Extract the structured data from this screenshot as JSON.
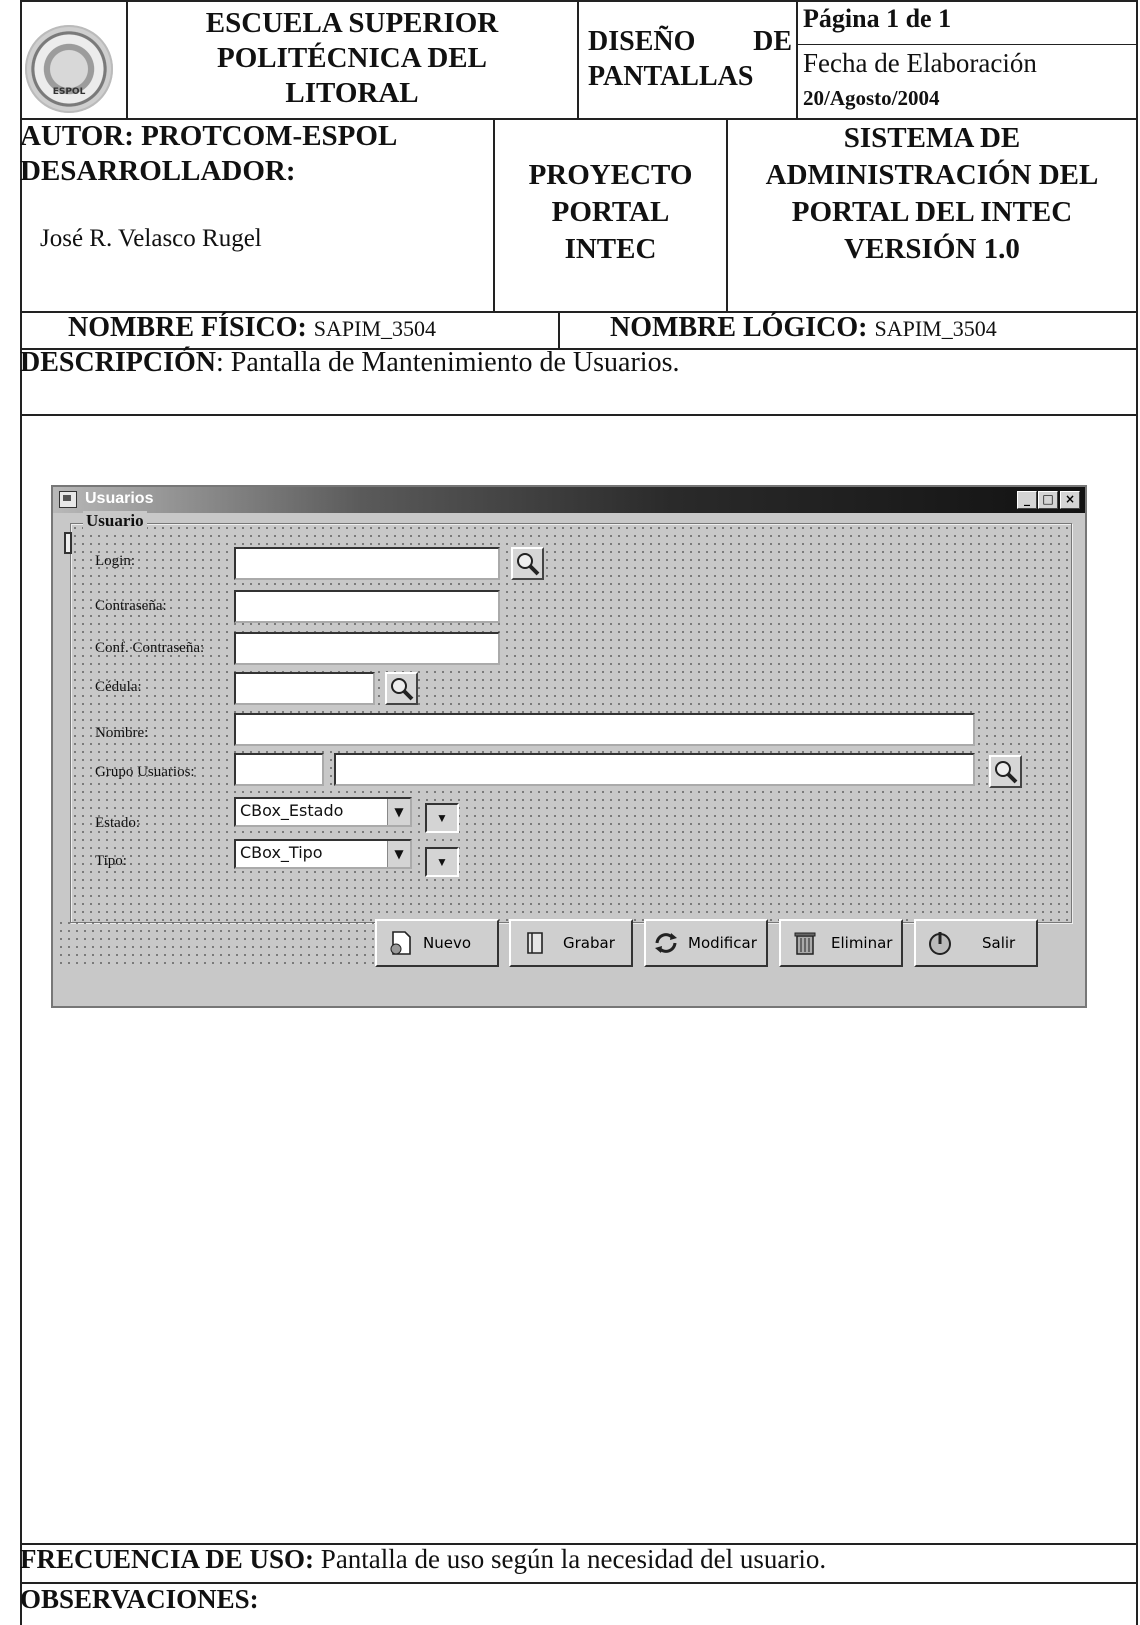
{
  "header": {
    "institution": [
      "ESCUELA SUPERIOR",
      "POLITÉCNICA DEL",
      "LITORAL"
    ],
    "doc_type": [
      "DISEÑO DE",
      "PANTALLAS"
    ],
    "page": "Página 1 de 1",
    "fecha_label": "Fecha de Elaboración",
    "fecha_value": "20/Agosto/2004",
    "seal_text": "ESPOL"
  },
  "info": {
    "autor": "AUTOR: PROTCOM-ESPOL",
    "desarrollador_label": "DESARROLLADOR:",
    "desarrollador_name": "José R. Velasco Rugel",
    "proyecto": [
      "PROYECTO",
      "PORTAL",
      "INTEC"
    ],
    "sistema": [
      "SISTEMA DE",
      "ADMINISTRACIÓN DEL",
      "PORTAL DEL INTEC",
      "VERSIÓN 1.0"
    ]
  },
  "nombres": {
    "fisico_label": "NOMBRE FÍSICO:",
    "fisico_value": "SAPIM_3504",
    "logico_label": "NOMBRE LÓGICO:",
    "logico_value": "SAPIM_3504"
  },
  "descripcion": {
    "label": "DESCRIPCIÓN",
    "text": ": Pantalla de Mantenimiento de Usuarios."
  },
  "window": {
    "title": "Usuarios",
    "group_title": "Usuario",
    "buttons_title": [
      "_",
      "□",
      "×"
    ],
    "fields": {
      "login": "Login:",
      "contrasena": "Contraseña:",
      "conf_contrasena": "Conf. Contraseña:",
      "cedula": "Cédula:",
      "nombre": "Nombre:",
      "grupo": "Grupo Usuarios:",
      "estado": "Estado:",
      "tipo": "Tipo:"
    },
    "combos": {
      "estado": "CBox_Estado",
      "tipo": "CBox_Tipo"
    },
    "actions": {
      "nuevo": "Nuevo",
      "grabar": "Grabar",
      "modificar": "Modificar",
      "eliminar": "Eliminar",
      "salir": "Salir"
    }
  },
  "footer": {
    "frecuencia_label": "FRECUENCIA DE USO:",
    "frecuencia_text": " Pantalla de uso según la necesidad del usuario.",
    "observaciones_label": "OBSERVACIONES:"
  }
}
